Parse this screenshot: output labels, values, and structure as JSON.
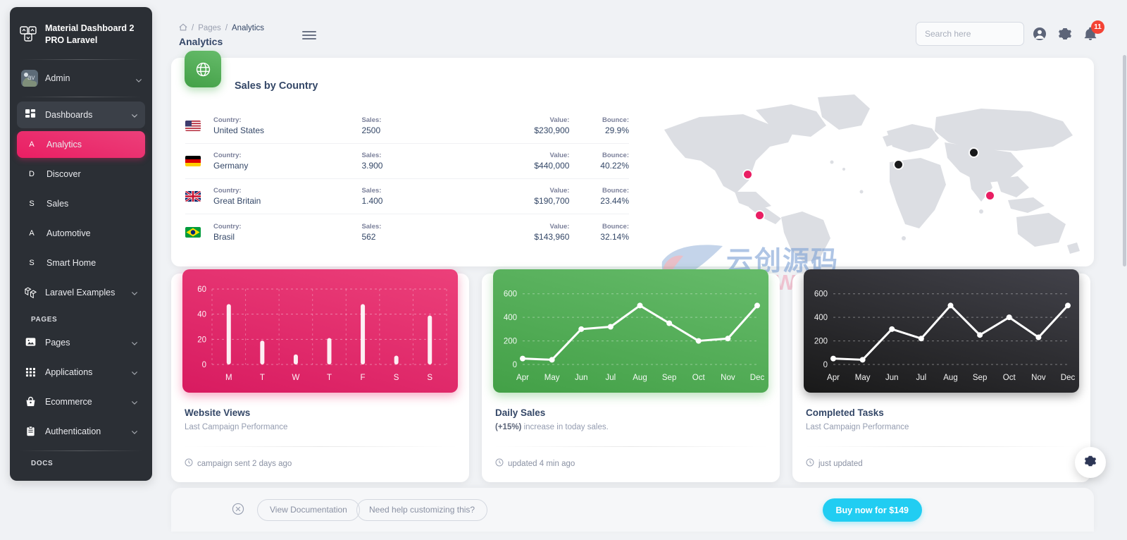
{
  "sidebar": {
    "brand": {
      "line1": "Material Dashboard 2",
      "line2": "PRO Laravel",
      "logo_icon": "squares-logo-icon"
    },
    "account": {
      "name": "Admin",
      "avatar_text": "av",
      "chevron_icon": "chevron-down-icon"
    },
    "nav": [
      {
        "label": "Dashboards",
        "icon": "dashboard-grid-icon",
        "type": "group",
        "chevron": true
      },
      {
        "label": "Analytics",
        "icon": "A",
        "type": "sub",
        "active": true
      },
      {
        "label": "Discover",
        "icon": "D",
        "type": "sub",
        "active": false
      },
      {
        "label": "Sales",
        "icon": "S",
        "type": "sub",
        "active": false
      },
      {
        "label": "Automotive",
        "icon": "A",
        "type": "sub",
        "active": false
      },
      {
        "label": "Smart Home",
        "icon": "S",
        "type": "sub",
        "active": false
      },
      {
        "label": "Laravel Examples",
        "icon": "laravel-icon",
        "type": "group-plain",
        "chevron": true
      }
    ],
    "section_pages": "PAGES",
    "pages_nav": [
      {
        "label": "Pages",
        "icon": "image-icon",
        "chevron": true
      },
      {
        "label": "Applications",
        "icon": "apps-grid-icon",
        "chevron": true
      },
      {
        "label": "Ecommerce",
        "icon": "basket-icon",
        "chevron": true
      },
      {
        "label": "Authentication",
        "icon": "clipboard-icon",
        "chevron": true
      }
    ],
    "section_docs": "DOCS"
  },
  "topbar": {
    "breadcrumb": {
      "home_icon": "home-icon",
      "sep": "/",
      "parent": "Pages",
      "current": "Analytics"
    },
    "page_title": "Analytics",
    "menu_toggle_icon": "hamburger-icon",
    "search": {
      "placeholder": "Search here",
      "value": ""
    },
    "icons": {
      "account": "account-circle-icon",
      "settings": "gear-icon",
      "notifications": "bell-icon"
    },
    "notification_count": "11"
  },
  "country_card": {
    "title": "Sales by Country",
    "icon": "globe-icon",
    "labels": {
      "country": "Country:",
      "sales": "Sales:",
      "value": "Value:",
      "bounce": "Bounce:"
    },
    "rows": [
      {
        "flag": "flag-us",
        "country": "United States",
        "sales": "2500",
        "value": "$230,900",
        "bounce": "29.9%"
      },
      {
        "flag": "flag-de",
        "country": "Germany",
        "sales": "3.900",
        "value": "$440,000",
        "bounce": "40.22%"
      },
      {
        "flag": "flag-gb",
        "country": "Great Britain",
        "sales": "1.400",
        "value": "$190,700",
        "bounce": "23.44%"
      },
      {
        "flag": "flag-br",
        "country": "Brasil",
        "sales": "562",
        "value": "$143,960",
        "bounce": "32.14%"
      }
    ],
    "map_markers": [
      {
        "name": "united-states-marker",
        "color": "#e91e63",
        "x": 0.225,
        "y": 0.48
      },
      {
        "name": "brazil-marker",
        "color": "#e91e63",
        "x": 0.25,
        "y": 0.72
      },
      {
        "name": "europe-marker",
        "color": "#18191b",
        "x": 0.565,
        "y": 0.42
      },
      {
        "name": "russia-marker",
        "color": "#18191b",
        "x": 0.72,
        "y": 0.36
      },
      {
        "name": "asia-marker",
        "color": "#e91e63",
        "x": 0.755,
        "y": 0.61
      }
    ]
  },
  "watermark": {
    "cn": "云创源码",
    "en": "LOOWP.COM"
  },
  "cards": {
    "views": {
      "title": "Website Views",
      "subtitle": "Last Campaign Performance",
      "footer": "campaign sent 2 days ago",
      "footer_icon": "clock-icon",
      "accent": "#D81B60"
    },
    "sales": {
      "title": "Daily Sales",
      "subtitle_strong": "(+15%)",
      "subtitle_rest": " increase in today sales.",
      "footer": "updated 4 min ago",
      "footer_icon": "clock-icon",
      "accent": "#43A047"
    },
    "tasks": {
      "title": "Completed Tasks",
      "subtitle": "Last Campaign Performance",
      "footer": "just updated",
      "footer_icon": "clock-icon",
      "accent": "#191919"
    }
  },
  "bottom_bar": {
    "close_icon": "close-circle-icon",
    "doc_button": "View Documentation",
    "help_button": "Need help customizing this?",
    "buy_button": "Buy now for $149"
  },
  "fab": {
    "icon": "gear-icon"
  },
  "chart_data": [
    {
      "type": "bar",
      "name": "website-views",
      "title": "Website Views",
      "categories": [
        "M",
        "T",
        "W",
        "T",
        "F",
        "S",
        "S"
      ],
      "values": [
        48,
        19,
        8,
        21,
        48,
        7,
        39
      ],
      "yticks": [
        0,
        20,
        40,
        60
      ],
      "ylim": [
        0,
        60
      ],
      "xlabel": "",
      "ylabel": "",
      "grid": true,
      "legend": "none",
      "colors": {
        "plot_bg": "#D81B60",
        "series": "#ffffff"
      }
    },
    {
      "type": "line",
      "name": "daily-sales",
      "title": "Daily Sales",
      "categories": [
        "Apr",
        "May",
        "Jun",
        "Jul",
        "Aug",
        "Sep",
        "Oct",
        "Nov",
        "Dec"
      ],
      "values": [
        50,
        40,
        300,
        320,
        500,
        350,
        200,
        220,
        500
      ],
      "yticks": [
        0,
        200,
        400,
        600
      ],
      "ylim": [
        0,
        640
      ],
      "xlabel": "",
      "ylabel": "",
      "grid": true,
      "legend": "none",
      "colors": {
        "plot_bg": "#43A047",
        "series": "#ffffff"
      }
    },
    {
      "type": "line",
      "name": "completed-tasks",
      "title": "Completed Tasks",
      "categories": [
        "Apr",
        "May",
        "Jun",
        "Jul",
        "Aug",
        "Sep",
        "Oct",
        "Nov",
        "Dec"
      ],
      "values": [
        50,
        40,
        300,
        220,
        500,
        250,
        400,
        230,
        500
      ],
      "yticks": [
        0,
        200,
        400,
        600
      ],
      "ylim": [
        0,
        640
      ],
      "xlabel": "",
      "ylabel": "",
      "grid": true,
      "legend": "none",
      "colors": {
        "plot_bg": "#191919",
        "series": "#ffffff"
      }
    }
  ]
}
